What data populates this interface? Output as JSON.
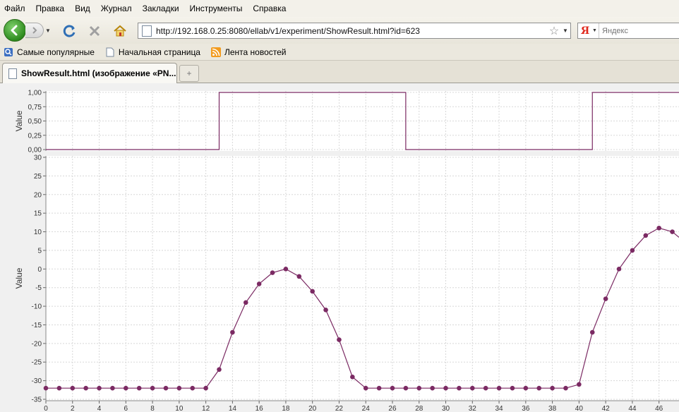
{
  "menubar": {
    "items": [
      "Файл",
      "Правка",
      "Вид",
      "Журнал",
      "Закладки",
      "Инструменты",
      "Справка"
    ]
  },
  "navbar": {
    "url": "http://192.168.0.25:8080/ellab/v1/experiment/ShowResult.html?id=623",
    "search_engine": "Я",
    "search_placeholder": "Яндекс"
  },
  "bookmarks": {
    "items": [
      "Самые популярные",
      "Начальная страница",
      "Лента новостей"
    ]
  },
  "tabs": {
    "active_label": "ShowResult.html (изображение «PN...",
    "new_tab_symbol": "+"
  },
  "colors": {
    "series": "#7b2a63",
    "plot_bg": "#ffffff",
    "grid": "#d8d8d8"
  },
  "chart_data": [
    {
      "type": "line",
      "step": true,
      "ylabel": "Value",
      "xlim": [
        0,
        47.5
      ],
      "ylim": [
        0,
        1
      ],
      "yticks": [
        "0,00",
        "0,25",
        "0,50",
        "0,75",
        "1,00"
      ],
      "ytick_values": [
        0,
        0.25,
        0.5,
        0.75,
        1
      ],
      "x": [
        0,
        13,
        27,
        41,
        47.5
      ],
      "y": [
        0,
        1,
        0,
        1,
        1
      ],
      "grid": true
    },
    {
      "type": "line",
      "markers": true,
      "ylabel": "Value",
      "xlim": [
        0,
        47.5
      ],
      "ylim": [
        -35,
        30
      ],
      "yticks": [
        "30",
        "25",
        "20",
        "15",
        "10",
        "5",
        "0",
        "-5",
        "-10",
        "-15",
        "-20",
        "-25",
        "-30",
        "-35"
      ],
      "ytick_values": [
        30,
        25,
        20,
        15,
        10,
        5,
        0,
        -5,
        -10,
        -15,
        -20,
        -25,
        -30,
        -35
      ],
      "xticks": [
        "0",
        "2",
        "4",
        "6",
        "8",
        "10",
        "12",
        "14",
        "16",
        "18",
        "20",
        "22",
        "24",
        "26",
        "28",
        "30",
        "32",
        "34",
        "36",
        "38",
        "40",
        "42",
        "44",
        "46"
      ],
      "xtick_values": [
        0,
        2,
        4,
        6,
        8,
        10,
        12,
        14,
        16,
        18,
        20,
        22,
        24,
        26,
        28,
        30,
        32,
        34,
        36,
        38,
        40,
        42,
        44,
        46
      ],
      "x": [
        0,
        1,
        2,
        3,
        4,
        5,
        6,
        7,
        8,
        9,
        10,
        11,
        12,
        13,
        14,
        15,
        16,
        17,
        18,
        19,
        20,
        21,
        22,
        23,
        24,
        25,
        26,
        27,
        28,
        29,
        30,
        31,
        32,
        33,
        34,
        35,
        36,
        37,
        38,
        39,
        40,
        41,
        42,
        43,
        44,
        45,
        46,
        47
      ],
      "y": [
        -32,
        -32,
        -32,
        -32,
        -32,
        -32,
        -32,
        -32,
        -32,
        -32,
        -32,
        -32,
        -32,
        -27,
        -17,
        -9,
        -4,
        -1,
        0,
        -2,
        -6,
        -11,
        -19,
        -29,
        -32,
        -32,
        -32,
        -32,
        -32,
        -32,
        -32,
        -32,
        -32,
        -32,
        -32,
        -32,
        -32,
        -32,
        -32,
        -32,
        -31,
        -17,
        -8,
        0,
        5,
        9,
        11,
        10
      ],
      "line_end": {
        "x": 47.5,
        "y": 8.5
      },
      "grid": true
    }
  ]
}
